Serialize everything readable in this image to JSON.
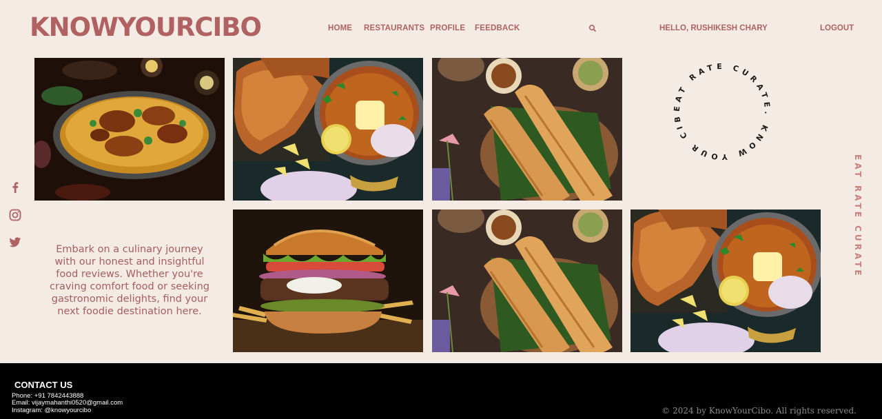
{
  "header": {
    "brand": "KNOWYOURCIBO",
    "nav": [
      "HOME",
      "RESTAURANTS",
      "PROFILE",
      "FEEDBACK"
    ],
    "search_icon": "search-icon",
    "greeting": "HELLO, RUSHIKESH CHARY",
    "logout": "LOGOUT"
  },
  "social": [
    "facebook-icon",
    "instagram-icon",
    "twitter-icon"
  ],
  "stamp": {
    "text": "EAT RATE CURATE. KNOW YOUR CIBO."
  },
  "vertical_tagline": "EAT RATE CURATE",
  "intro": "Embark on a culinary journey with our honest and insightful food reviews. Whether you're craving comfort food or seeking gastronomic delights, find your next foodie destination here.",
  "gallery": [
    {
      "name": "biryani-image"
    },
    {
      "name": "pav-bhaji-image"
    },
    {
      "name": "dosa-image"
    },
    {
      "name": "burger-image"
    },
    {
      "name": "dosa-image-2"
    },
    {
      "name": "pav-bhaji-image-2"
    }
  ],
  "footer": {
    "title": "CONTACT US",
    "phone": "Phone: +91 7842443888",
    "email": "Email: vijaymahanthi0520@gmail.com",
    "instagram": "Instagram: @knowyourcibo",
    "copyright": "© 2024 by KnowYourCibo. All rights reserved."
  },
  "colors": {
    "accent": "#b06161",
    "background": "#f4ebe4",
    "footer": "#000000"
  }
}
